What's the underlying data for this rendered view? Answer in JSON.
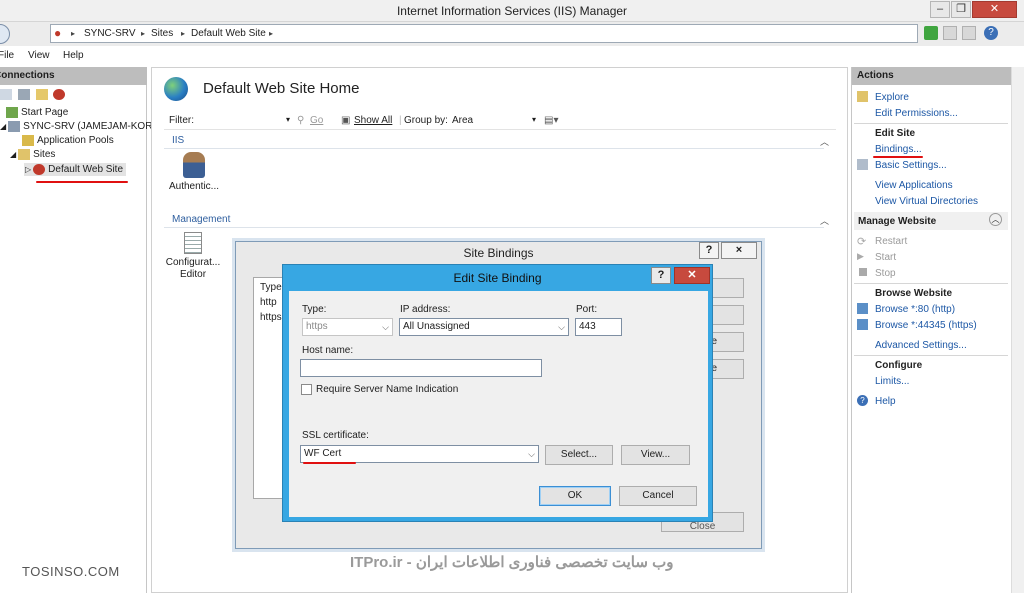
{
  "window": {
    "title": "Internet Information Services (IIS) Manager"
  },
  "address": {
    "crumbs": [
      "SYNC-SRV",
      "Sites",
      "Default Web Site"
    ]
  },
  "menu": {
    "file": "File",
    "view": "View",
    "help": "Help"
  },
  "connections": {
    "header": "Connections",
    "nodes": [
      "Start Page",
      "SYNC-SRV (JAMEJAM-KOREH",
      "Application Pools",
      "Sites",
      "Default Web Site"
    ]
  },
  "main": {
    "title": "Default Web Site Home",
    "filter_label": "Filter:",
    "go_label": "Go",
    "show_all_label": "Show All",
    "group_by_label": "Group by:",
    "group_by_value": "Area",
    "sections": {
      "iis": "IIS",
      "management": "Management"
    },
    "features": {
      "auth": "Authentic...",
      "config_editor": "Configurat... Editor"
    }
  },
  "site_bindings": {
    "title": "Site Bindings",
    "list_header": "Type",
    "rows": [
      "http",
      "https"
    ],
    "close_fragment": "Close",
    "edit_fragment": "e",
    "remove_fragment": "e",
    "help": "?",
    "x": "×"
  },
  "edit_binding": {
    "title": "Edit Site Binding",
    "type_label": "Type:",
    "type_value": "https",
    "ip_label": "IP address:",
    "ip_value": "All Unassigned",
    "port_label": "Port:",
    "port_value": "443",
    "host_label": "Host name:",
    "host_value": "",
    "sni_label": "Require Server Name Indication",
    "ssl_label": "SSL certificate:",
    "ssl_value": "WF Cert",
    "select_label": "Select...",
    "view_label": "View...",
    "ok_label": "OK",
    "cancel_label": "Cancel",
    "help": "?",
    "x": "✕"
  },
  "actions": {
    "header": "Actions",
    "explore": "Explore",
    "edit_permissions": "Edit Permissions...",
    "edit_site": "Edit Site",
    "bindings": "Bindings...",
    "basic_settings": "Basic Settings...",
    "view_applications": "View Applications",
    "view_virtual_dirs": "View Virtual Directories",
    "manage_website": "Manage Website",
    "restart": "Restart",
    "start": "Start",
    "stop": "Stop",
    "browse_website": "Browse Website",
    "browse_http": "Browse *:80 (http)",
    "browse_https": "Browse *:44345 (https)",
    "advanced_settings": "Advanced Settings...",
    "configure": "Configure",
    "limits": "Limits...",
    "help": "Help"
  },
  "watermarks": {
    "left": "TOSINSO.COM",
    "center": "ITPro.ir - وب سایت تخصصی فناوری اطلاعات ایران"
  },
  "colors": {
    "dialog_border": "#37a7e3",
    "link": "#1c57a5",
    "annotation": "#e01010"
  }
}
